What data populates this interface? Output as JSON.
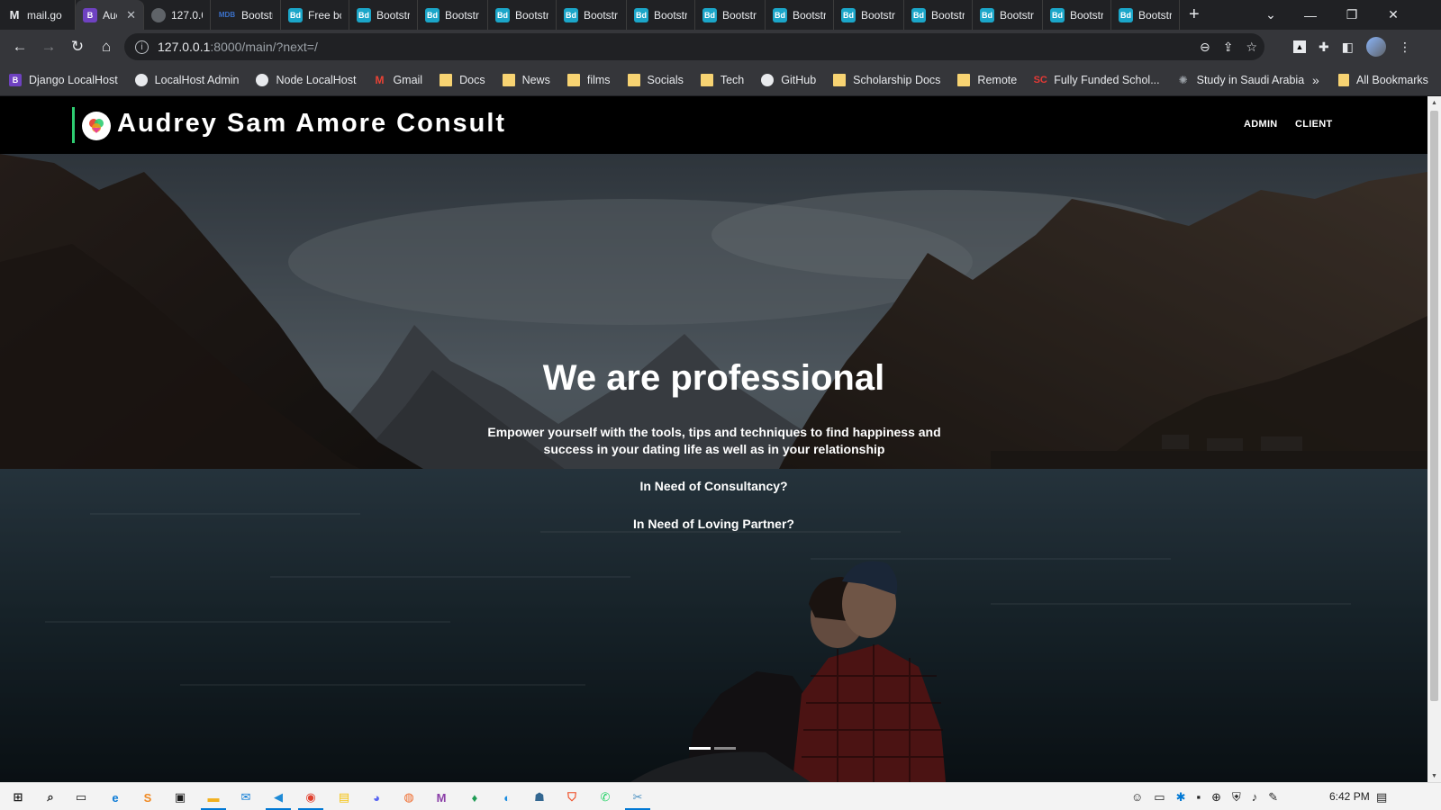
{
  "browser": {
    "tabs": [
      {
        "title": "mail.go",
        "icon": "gmail-icon",
        "favicon_text": "M",
        "kind": "gmail",
        "width": 84
      },
      {
        "title": "Auc",
        "icon": "bootstrap-icon",
        "favicon_text": "B",
        "kind": "boot-b",
        "width": 76,
        "active": true
      },
      {
        "title": "127.0.0",
        "icon": "globe-icon",
        "favicon_text": "",
        "kind": "globe",
        "width": 74
      },
      {
        "title": "Bootstr",
        "icon": "mdb-icon",
        "favicon_text": "MDB",
        "kind": "mdb",
        "width": 78
      },
      {
        "title": "Free bc",
        "icon": "bd-icon",
        "favicon_text": "Bd",
        "kind": "bd",
        "width": 76
      },
      {
        "title": "Bootstr",
        "icon": "bd-icon",
        "favicon_text": "Bd",
        "kind": "bd",
        "width": 76
      },
      {
        "title": "Bootstr",
        "icon": "bd-icon",
        "favicon_text": "Bd",
        "kind": "bd",
        "width": 78
      },
      {
        "title": "Bootstr",
        "icon": "bd-icon",
        "favicon_text": "Bd",
        "kind": "bd",
        "width": 76
      },
      {
        "title": "Bootstr",
        "icon": "bd-icon",
        "favicon_text": "Bd",
        "kind": "bd",
        "width": 78
      },
      {
        "title": "Bootstr",
        "icon": "bd-icon",
        "favicon_text": "Bd",
        "kind": "bd",
        "width": 76
      },
      {
        "title": "Bootstr",
        "icon": "bd-icon",
        "favicon_text": "Bd",
        "kind": "bd",
        "width": 78
      },
      {
        "title": "Bootstr",
        "icon": "bd-icon",
        "favicon_text": "Bd",
        "kind": "bd",
        "width": 76
      },
      {
        "title": "Bootstr",
        "icon": "bd-icon",
        "favicon_text": "Bd",
        "kind": "bd",
        "width": 78
      },
      {
        "title": "Bootstr",
        "icon": "bd-icon",
        "favicon_text": "Bd",
        "kind": "bd",
        "width": 76
      },
      {
        "title": "Bootstr",
        "icon": "bd-icon",
        "favicon_text": "Bd",
        "kind": "bd",
        "width": 78
      },
      {
        "title": "Bootstr",
        "icon": "bd-icon",
        "favicon_text": "Bd",
        "kind": "bd",
        "width": 76
      },
      {
        "title": "Bootstr",
        "icon": "bd-icon",
        "favicon_text": "Bd",
        "kind": "bd",
        "width": 76
      }
    ],
    "new_tab_label": "+",
    "address": {
      "host": "127.0.0.1",
      "path": ":8000/main/?next=/"
    },
    "bookmarks": [
      {
        "label": "Django LocalHost",
        "icon": "bootstrap-icon",
        "kind": "b",
        "glyph": "B"
      },
      {
        "label": "LocalHost Admin",
        "icon": "globe-icon",
        "kind": "globe",
        "glyph": ""
      },
      {
        "label": "Node LocalHost",
        "icon": "globe-icon",
        "kind": "globe",
        "glyph": ""
      },
      {
        "label": "Gmail",
        "icon": "gmail-icon",
        "kind": "gm",
        "glyph": "M"
      },
      {
        "label": "Docs",
        "icon": "folder-icon",
        "kind": "folder",
        "glyph": ""
      },
      {
        "label": "News",
        "icon": "folder-icon",
        "kind": "folder",
        "glyph": ""
      },
      {
        "label": "films",
        "icon": "folder-icon",
        "kind": "folder",
        "glyph": ""
      },
      {
        "label": "Socials",
        "icon": "folder-icon",
        "kind": "folder",
        "glyph": ""
      },
      {
        "label": "Tech",
        "icon": "folder-icon",
        "kind": "folder",
        "glyph": ""
      },
      {
        "label": "GitHub",
        "icon": "globe-icon",
        "kind": "globe",
        "glyph": ""
      },
      {
        "label": "Scholarship Docs",
        "icon": "folder-icon",
        "kind": "folder",
        "glyph": ""
      },
      {
        "label": "Remote",
        "icon": "folder-icon",
        "kind": "folder",
        "glyph": ""
      },
      {
        "label": "Fully Funded Schol...",
        "icon": "sc-icon",
        "kind": "sc",
        "glyph": "SC"
      },
      {
        "label": "Study in Saudi Arabia",
        "icon": "star-icon",
        "kind": "star",
        "glyph": "✺"
      }
    ],
    "more_bookmarks": "»",
    "all_bookmarks": "All Bookmarks"
  },
  "site": {
    "brand": "Audrey Sam Amore Consult",
    "nav": [
      "ADMIN",
      "CLIENT"
    ],
    "hero": {
      "title": "We are professional",
      "description": "Empower yourself with the tools, tips and techniques to find happiness and success in your dating life as well as in your relationship",
      "link_consultancy": "In Need of Consultancy?",
      "link_partner": "In Need of Loving Partner?",
      "slide_count": 2,
      "active_slide": 1
    }
  },
  "taskbar": {
    "clock": "6:42 PM",
    "apps": [
      {
        "name": "start-icon",
        "glyph": "⊞",
        "color": "#1a1a1a"
      },
      {
        "name": "search-icon",
        "glyph": "⌕",
        "color": "#1a1a1a"
      },
      {
        "name": "task-view-icon",
        "glyph": "▭",
        "color": "#1a1a1a"
      },
      {
        "name": "edge-icon",
        "glyph": "e",
        "color": "#0c7bd6"
      },
      {
        "name": "sublime-icon",
        "glyph": "S",
        "color": "#f08a24"
      },
      {
        "name": "store-icon",
        "glyph": "▣",
        "color": "#1a1a1a"
      },
      {
        "name": "file-explorer-icon",
        "glyph": "▬",
        "color": "#f2b01e"
      },
      {
        "name": "mail-icon",
        "glyph": "✉",
        "color": "#0c7bd6"
      },
      {
        "name": "vscode-icon",
        "glyph": "◀",
        "color": "#1e8ad6"
      },
      {
        "name": "chrome-icon",
        "glyph": "◉",
        "color": "#e0412f"
      },
      {
        "name": "notes-icon",
        "glyph": "▤",
        "color": "#f4c20d"
      },
      {
        "name": "discord-icon",
        "glyph": "◕",
        "color": "#5865f2"
      },
      {
        "name": "postman-icon",
        "glyph": "◍",
        "color": "#ef6a2b"
      },
      {
        "name": "m-app-icon",
        "glyph": "M",
        "color": "#8b3fa8"
      },
      {
        "name": "mongodb-icon",
        "glyph": "♦",
        "color": "#1e9b54"
      },
      {
        "name": "bird-icon",
        "glyph": "◐",
        "color": "#1a8ce0"
      },
      {
        "name": "postgres-icon",
        "glyph": "☗",
        "color": "#336791"
      },
      {
        "name": "brave-icon",
        "glyph": "⛉",
        "color": "#f0522a"
      },
      {
        "name": "whatsapp-icon",
        "glyph": "✆",
        "color": "#25d366"
      },
      {
        "name": "snipping-icon",
        "glyph": "✂",
        "color": "#4a90c2"
      }
    ]
  },
  "colors": {
    "brand_accent": "#2ecc71",
    "nav_bg": "#000000",
    "chrome_dark": "#202124"
  }
}
